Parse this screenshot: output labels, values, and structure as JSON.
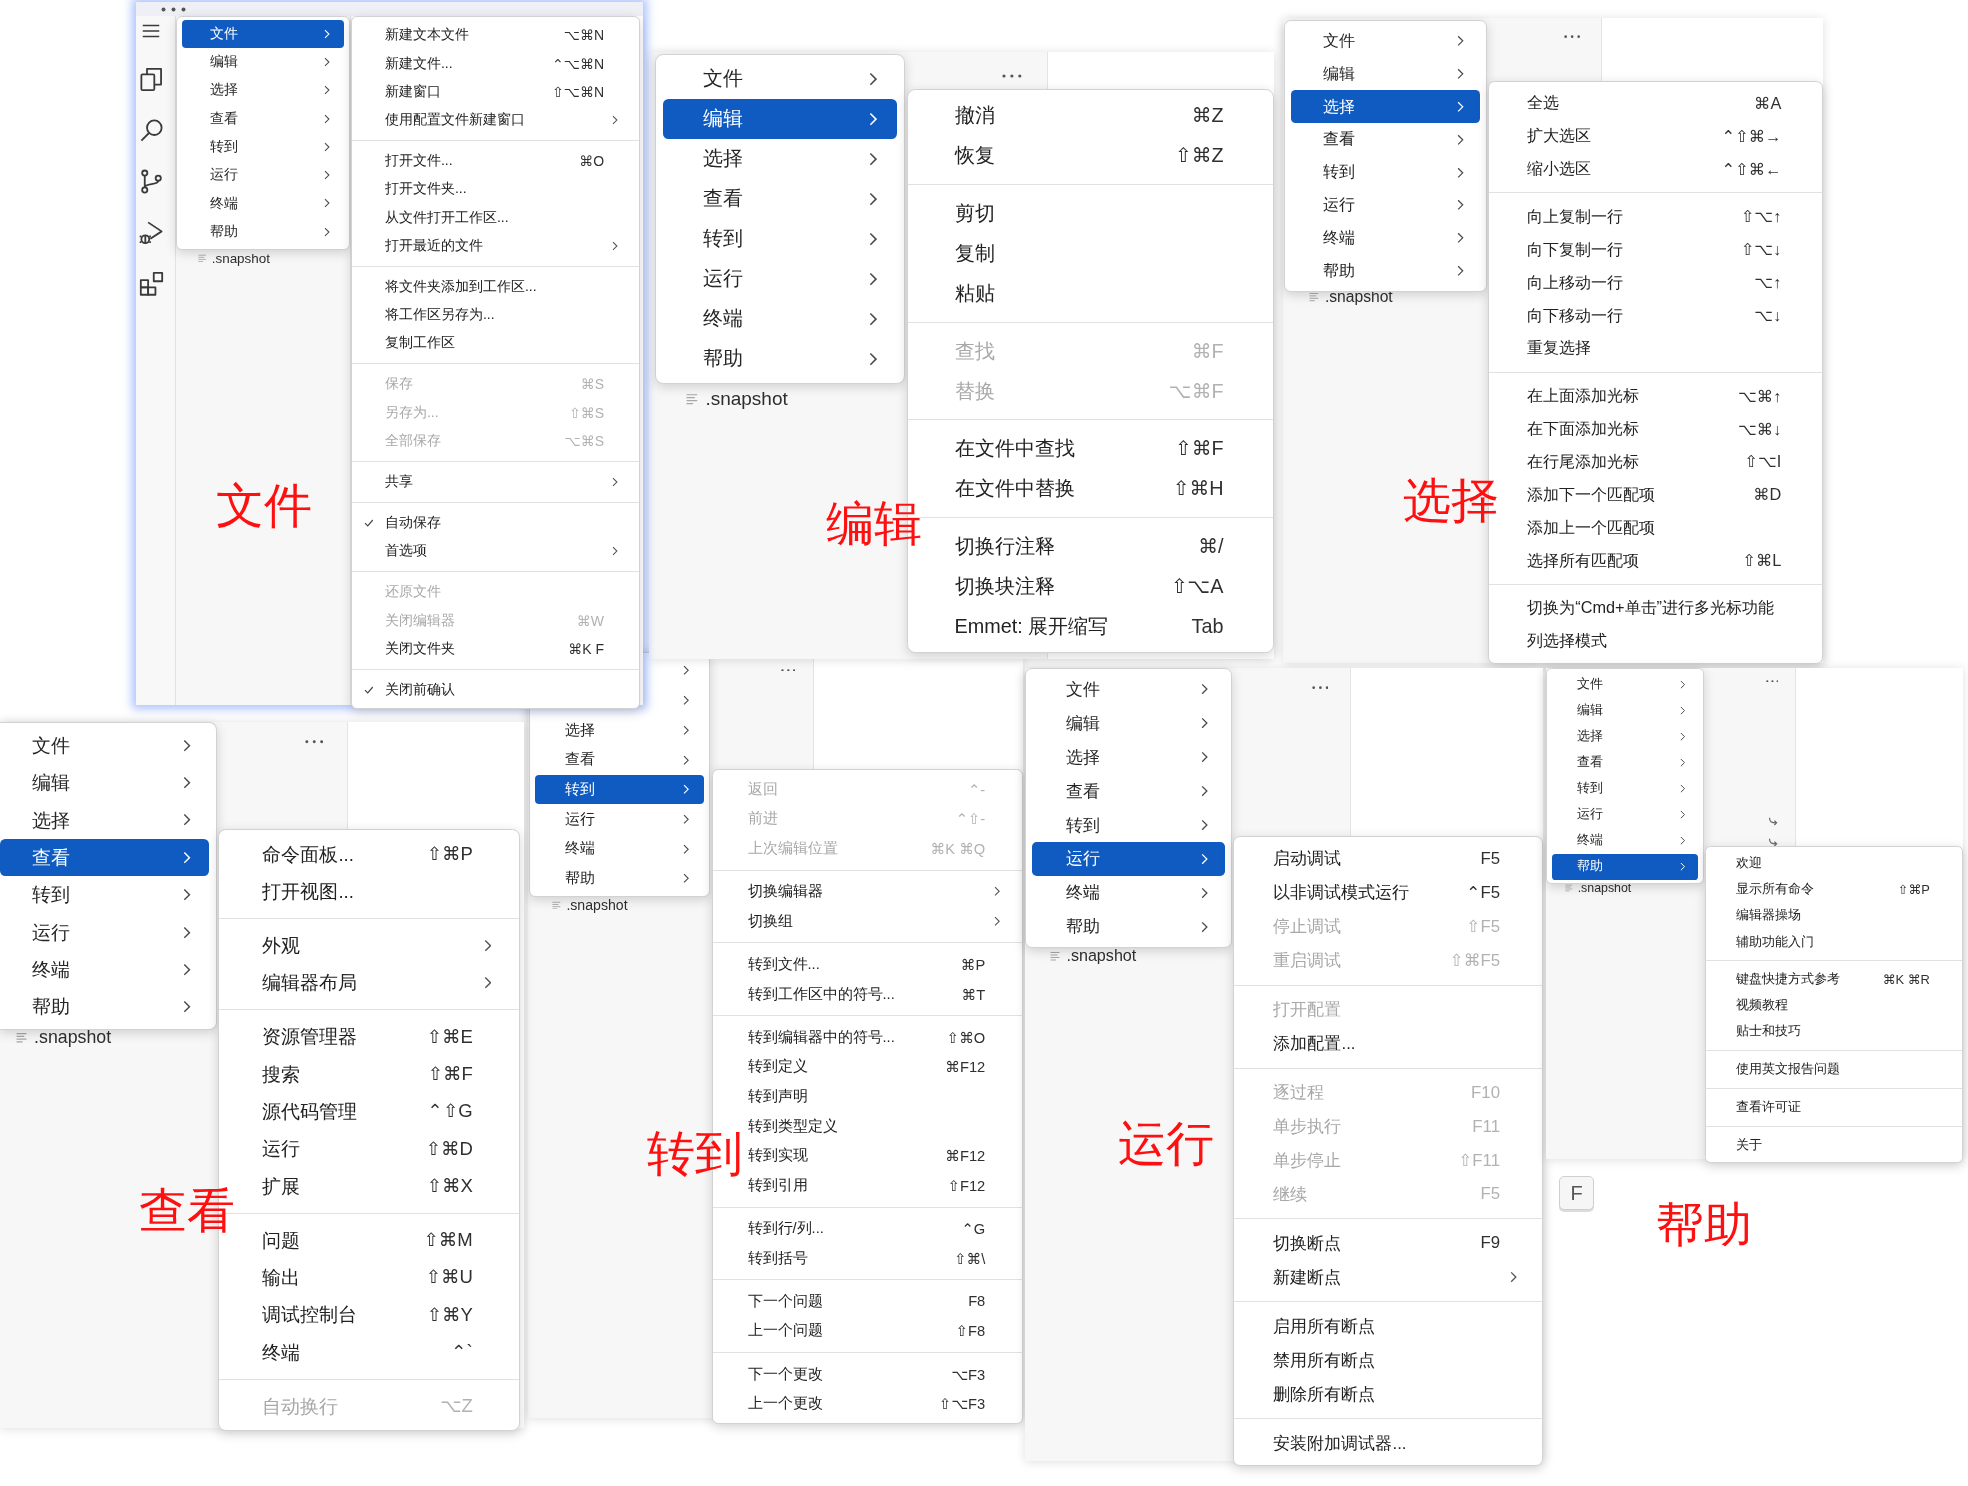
{
  "panels": [
    {
      "menu": [
        {
          "label": "文件",
          "selected": true
        },
        {
          "label": "编辑",
          "selected": false
        },
        {
          "label": "选择",
          "selected": false
        },
        {
          "label": "查看",
          "selected": false
        },
        {
          "label": "转到",
          "selected": false
        },
        {
          "label": "运行",
          "selected": false
        },
        {
          "label": "终端",
          "selected": false
        },
        {
          "label": "帮助",
          "selected": false
        }
      ],
      "file": ".snapshot",
      "submenu": [
        {
          "items": [
            {
              "label": "新建文本文件",
              "shortcut": "⌥⌘N",
              "disabled": false,
              "checked": false,
              "has_submenu": false
            },
            {
              "label": "新建文件...",
              "shortcut": "⌃⌥⌘N",
              "disabled": false,
              "checked": false,
              "has_submenu": false
            },
            {
              "label": "新建窗口",
              "shortcut": "⇧⌥⌘N",
              "disabled": false,
              "checked": false,
              "has_submenu": false
            },
            {
              "label": "使用配置文件新建窗口",
              "disabled": false,
              "checked": false,
              "has_submenu": true
            }
          ]
        },
        {
          "items": [
            {
              "label": "打开文件...",
              "shortcut": "⌘O",
              "disabled": false,
              "checked": false,
              "has_submenu": false
            },
            {
              "label": "打开文件夹...",
              "disabled": false,
              "checked": false,
              "has_submenu": false
            },
            {
              "label": "从文件打开工作区...",
              "disabled": false,
              "checked": false,
              "has_submenu": false
            },
            {
              "label": "打开最近的文件",
              "disabled": false,
              "checked": false,
              "has_submenu": true
            }
          ]
        },
        {
          "items": [
            {
              "label": "将文件夹添加到工作区...",
              "disabled": false,
              "checked": false,
              "has_submenu": false
            },
            {
              "label": "将工作区另存为...",
              "disabled": false,
              "checked": false,
              "has_submenu": false
            },
            {
              "label": "复制工作区",
              "disabled": false,
              "checked": false,
              "has_submenu": false
            }
          ]
        },
        {
          "items": [
            {
              "label": "保存",
              "shortcut": "⌘S",
              "disabled": true,
              "checked": false,
              "has_submenu": false
            },
            {
              "label": "另存为...",
              "shortcut": "⇧⌘S",
              "disabled": true,
              "checked": false,
              "has_submenu": false
            },
            {
              "label": "全部保存",
              "shortcut": "⌥⌘S",
              "disabled": true,
              "checked": false,
              "has_submenu": false
            }
          ]
        },
        {
          "items": [
            {
              "label": "共享",
              "disabled": false,
              "checked": false,
              "has_submenu": true
            }
          ]
        },
        {
          "items": [
            {
              "label": "自动保存",
              "disabled": false,
              "checked": true,
              "has_submenu": false
            },
            {
              "label": "首选项",
              "disabled": false,
              "checked": false,
              "has_submenu": true
            }
          ]
        },
        {
          "items": [
            {
              "label": "还原文件",
              "disabled": true,
              "checked": false,
              "has_submenu": false
            },
            {
              "label": "关闭编辑器",
              "shortcut": "⌘W",
              "disabled": true,
              "checked": false,
              "has_submenu": false
            },
            {
              "label": "关闭文件夹",
              "shortcut": "⌘K F",
              "disabled": false,
              "checked": false,
              "has_submenu": false
            }
          ]
        },
        {
          "items": [
            {
              "label": "关闭前确认",
              "disabled": false,
              "checked": true,
              "has_submenu": false
            }
          ]
        }
      ],
      "caption": "文件"
    },
    {
      "menu": [
        {
          "label": "文件",
          "selected": false
        },
        {
          "label": "编辑",
          "selected": true
        },
        {
          "label": "选择",
          "selected": false
        },
        {
          "label": "查看",
          "selected": false
        },
        {
          "label": "转到",
          "selected": false
        },
        {
          "label": "运行",
          "selected": false
        },
        {
          "label": "终端",
          "selected": false
        },
        {
          "label": "帮助",
          "selected": false
        }
      ],
      "file": ".snapshot",
      "submenu": [
        {
          "items": [
            {
              "label": "撤消",
              "shortcut": "⌘Z",
              "disabled": false,
              "has_submenu": false
            },
            {
              "label": "恢复",
              "shortcut": "⇧⌘Z",
              "disabled": false,
              "has_submenu": false
            }
          ]
        },
        {
          "items": [
            {
              "label": "剪切",
              "disabled": false,
              "has_submenu": false
            },
            {
              "label": "复制",
              "disabled": false,
              "has_submenu": false
            },
            {
              "label": "粘贴",
              "disabled": false,
              "has_submenu": false
            }
          ]
        },
        {
          "items": [
            {
              "label": "查找",
              "shortcut": "⌘F",
              "disabled": true,
              "has_submenu": false
            },
            {
              "label": "替换",
              "shortcut": "⌥⌘F",
              "disabled": true,
              "has_submenu": false
            }
          ]
        },
        {
          "items": [
            {
              "label": "在文件中查找",
              "shortcut": "⇧⌘F",
              "disabled": false,
              "has_submenu": false
            },
            {
              "label": "在文件中替换",
              "shortcut": "⇧⌘H",
              "disabled": false,
              "has_submenu": false
            }
          ]
        },
        {
          "items": [
            {
              "label": "切换行注释",
              "shortcut": "⌘/",
              "disabled": false,
              "has_submenu": false
            },
            {
              "label": "切换块注释",
              "shortcut": "⇧⌥A",
              "disabled": false,
              "has_submenu": false
            },
            {
              "label": "Emmet: 展开缩写",
              "shortcut": "Tab",
              "disabled": false,
              "has_submenu": false
            }
          ]
        }
      ],
      "caption": "编辑"
    },
    {
      "menu": [
        {
          "label": "文件",
          "selected": false
        },
        {
          "label": "编辑",
          "selected": false
        },
        {
          "label": "选择",
          "selected": true
        },
        {
          "label": "查看",
          "selected": false
        },
        {
          "label": "转到",
          "selected": false
        },
        {
          "label": "运行",
          "selected": false
        },
        {
          "label": "终端",
          "selected": false
        },
        {
          "label": "帮助",
          "selected": false
        }
      ],
      "file": ".snapshot",
      "submenu": [
        {
          "items": [
            {
              "label": "全选",
              "shortcut": "⌘A",
              "disabled": false,
              "has_submenu": false
            },
            {
              "label": "扩大选区",
              "shortcut": "⌃⇧⌘→",
              "disabled": false,
              "has_submenu": false
            },
            {
              "label": "缩小选区",
              "shortcut": "⌃⇧⌘←",
              "disabled": false,
              "has_submenu": false
            }
          ]
        },
        {
          "items": [
            {
              "label": "向上复制一行",
              "shortcut": "⇧⌥↑",
              "disabled": false,
              "has_submenu": false
            },
            {
              "label": "向下复制一行",
              "shortcut": "⇧⌥↓",
              "disabled": false,
              "has_submenu": false
            },
            {
              "label": "向上移动一行",
              "shortcut": "⌥↑",
              "disabled": false,
              "has_submenu": false
            },
            {
              "label": "向下移动一行",
              "shortcut": "⌥↓",
              "disabled": false,
              "has_submenu": false
            },
            {
              "label": "重复选择",
              "disabled": false,
              "has_submenu": false
            }
          ]
        },
        {
          "items": [
            {
              "label": "在上面添加光标",
              "shortcut": "⌥⌘↑",
              "disabled": false,
              "has_submenu": false
            },
            {
              "label": "在下面添加光标",
              "shortcut": "⌥⌘↓",
              "disabled": false,
              "has_submenu": false
            },
            {
              "label": "在行尾添加光标",
              "shortcut": "⇧⌥I",
              "disabled": false,
              "has_submenu": false
            },
            {
              "label": "添加下一个匹配项",
              "shortcut": "⌘D",
              "disabled": false,
              "has_submenu": false
            },
            {
              "label": "添加上一个匹配项",
              "disabled": false,
              "has_submenu": false
            },
            {
              "label": "选择所有匹配项",
              "shortcut": "⇧⌘L",
              "disabled": false,
              "has_submenu": false
            }
          ]
        },
        {
          "items": [
            {
              "label": "切换为“Cmd+单击”进行多光标功能",
              "disabled": false,
              "has_submenu": false
            },
            {
              "label": "列选择模式",
              "disabled": false,
              "has_submenu": false
            }
          ]
        }
      ],
      "caption": "选择"
    },
    {
      "menu": [
        {
          "label": "文件",
          "selected": false
        },
        {
          "label": "编辑",
          "selected": false
        },
        {
          "label": "选择",
          "selected": false
        },
        {
          "label": "查看",
          "selected": true
        },
        {
          "label": "转到",
          "selected": false
        },
        {
          "label": "运行",
          "selected": false
        },
        {
          "label": "终端",
          "selected": false
        },
        {
          "label": "帮助",
          "selected": false
        }
      ],
      "file": ".snapshot",
      "submenu": [
        {
          "items": [
            {
              "label": "命令面板...",
              "shortcut": "⇧⌘P",
              "disabled": false,
              "has_submenu": false
            },
            {
              "label": "打开视图...",
              "disabled": false,
              "has_submenu": false
            }
          ]
        },
        {
          "items": [
            {
              "label": "外观",
              "disabled": false,
              "has_submenu": true
            },
            {
              "label": "编辑器布局",
              "disabled": false,
              "has_submenu": true
            }
          ]
        },
        {
          "items": [
            {
              "label": "资源管理器",
              "shortcut": "⇧⌘E",
              "disabled": false,
              "has_submenu": false
            },
            {
              "label": "搜索",
              "shortcut": "⇧⌘F",
              "disabled": false,
              "has_submenu": false
            },
            {
              "label": "源代码管理",
              "shortcut": "⌃⇧G",
              "disabled": false,
              "has_submenu": false
            },
            {
              "label": "运行",
              "shortcut": "⇧⌘D",
              "disabled": false,
              "has_submenu": false
            },
            {
              "label": "扩展",
              "shortcut": "⇧⌘X",
              "disabled": false,
              "has_submenu": false
            }
          ]
        },
        {
          "items": [
            {
              "label": "问题",
              "shortcut": "⇧⌘M",
              "disabled": false,
              "has_submenu": false
            },
            {
              "label": "输出",
              "shortcut": "⇧⌘U",
              "disabled": false,
              "has_submenu": false
            },
            {
              "label": "调试控制台",
              "shortcut": "⇧⌘Y",
              "disabled": false,
              "has_submenu": false
            },
            {
              "label": "终端",
              "shortcut": "⌃`",
              "disabled": false,
              "has_submenu": false
            }
          ]
        },
        {
          "items": [
            {
              "label": "自动换行",
              "shortcut": "⌥Z",
              "disabled": true,
              "has_submenu": false
            }
          ]
        }
      ],
      "caption": "查看"
    },
    {
      "menu": [
        {
          "selected": false
        },
        {
          "selected": false
        },
        {
          "label": "选择",
          "selected": false
        },
        {
          "label": "查看",
          "selected": false
        },
        {
          "label": "转到",
          "selected": true
        },
        {
          "label": "运行",
          "selected": false
        },
        {
          "label": "终端",
          "selected": false
        },
        {
          "label": "帮助",
          "selected": false
        }
      ],
      "file": ".snapshot",
      "submenu": [
        {
          "items": [
            {
              "label": "返回",
              "shortcut": "⌃-",
              "disabled": true,
              "has_submenu": false
            },
            {
              "label": "前进",
              "shortcut": "⌃⇧-",
              "disabled": true,
              "has_submenu": false
            },
            {
              "label": "上次编辑位置",
              "shortcut": "⌘K ⌘Q",
              "disabled": true,
              "has_submenu": false
            }
          ]
        },
        {
          "items": [
            {
              "label": "切换编辑器",
              "disabled": false,
              "has_submenu": true
            },
            {
              "label": "切换组",
              "disabled": false,
              "has_submenu": true
            }
          ]
        },
        {
          "items": [
            {
              "label": "转到文件...",
              "shortcut": "⌘P",
              "disabled": false,
              "has_submenu": false
            },
            {
              "label": "转到工作区中的符号...",
              "shortcut": "⌘T",
              "disabled": false,
              "has_submenu": false
            }
          ]
        },
        {
          "items": [
            {
              "label": "转到编辑器中的符号...",
              "shortcut": "⇧⌘O",
              "disabled": false,
              "has_submenu": false
            },
            {
              "label": "转到定义",
              "shortcut": "⌘F12",
              "disabled": false,
              "has_submenu": false
            },
            {
              "label": "转到声明",
              "disabled": false,
              "has_submenu": false
            },
            {
              "label": "转到类型定义",
              "disabled": false,
              "has_submenu": false
            },
            {
              "label": "转到实现",
              "shortcut": "⌘F12",
              "disabled": false,
              "has_submenu": false
            },
            {
              "label": "转到引用",
              "shortcut": "⇧F12",
              "disabled": false,
              "has_submenu": false
            }
          ]
        },
        {
          "items": [
            {
              "label": "转到行/列...",
              "shortcut": "⌃G",
              "disabled": false,
              "has_submenu": false
            },
            {
              "label": "转到括号",
              "shortcut": "⇧⌘\\",
              "disabled": false,
              "has_submenu": false
            }
          ]
        },
        {
          "items": [
            {
              "label": "下一个问题",
              "shortcut": "F8",
              "disabled": false,
              "has_submenu": false
            },
            {
              "label": "上一个问题",
              "shortcut": "⇧F8",
              "disabled": false,
              "has_submenu": false
            }
          ]
        },
        {
          "items": [
            {
              "label": "下一个更改",
              "shortcut": "⌥F3",
              "disabled": false,
              "has_submenu": false
            },
            {
              "label": "上一个更改",
              "shortcut": "⇧⌥F3",
              "disabled": false,
              "has_submenu": false
            }
          ]
        }
      ],
      "caption": "转到"
    },
    {
      "menu": [
        {
          "label": "文件",
          "selected": false
        },
        {
          "label": "编辑",
          "selected": false
        },
        {
          "label": "选择",
          "selected": false
        },
        {
          "label": "查看",
          "selected": false
        },
        {
          "label": "转到",
          "selected": false
        },
        {
          "label": "运行",
          "selected": true
        },
        {
          "label": "终端",
          "selected": false
        },
        {
          "label": "帮助",
          "selected": false
        }
      ],
      "file": ".snapshot",
      "submenu": [
        {
          "items": [
            {
              "label": "启动调试",
              "shortcut": "F5",
              "disabled": false,
              "has_submenu": false
            },
            {
              "label": "以非调试模式运行",
              "shortcut": "⌃F5",
              "disabled": false,
              "has_submenu": false
            },
            {
              "label": "停止调试",
              "shortcut": "⇧F5",
              "disabled": true,
              "has_submenu": false
            },
            {
              "label": "重启调试",
              "shortcut": "⇧⌘F5",
              "disabled": true,
              "has_submenu": false
            }
          ]
        },
        {
          "items": [
            {
              "label": "打开配置",
              "disabled": true,
              "has_submenu": false
            },
            {
              "label": "添加配置...",
              "disabled": false,
              "has_submenu": false
            }
          ]
        },
        {
          "items": [
            {
              "label": "逐过程",
              "shortcut": "F10",
              "disabled": true,
              "has_submenu": false
            },
            {
              "label": "单步执行",
              "shortcut": "F11",
              "disabled": true,
              "has_submenu": false
            },
            {
              "label": "单步停止",
              "shortcut": "⇧F11",
              "disabled": true,
              "has_submenu": false
            },
            {
              "label": "继续",
              "shortcut": "F5",
              "disabled": true,
              "has_submenu": false
            }
          ]
        },
        {
          "items": [
            {
              "label": "切换断点",
              "shortcut": "F9",
              "disabled": false,
              "has_submenu": false
            },
            {
              "label": "新建断点",
              "disabled": false,
              "has_submenu": true
            }
          ]
        },
        {
          "items": [
            {
              "label": "启用所有断点",
              "disabled": false,
              "has_submenu": false
            },
            {
              "label": "禁用所有断点",
              "disabled": false,
              "has_submenu": false
            },
            {
              "label": "删除所有断点",
              "disabled": false,
              "has_submenu": false
            }
          ]
        },
        {
          "items": [
            {
              "label": "安装附加调试器...",
              "disabled": false,
              "has_submenu": false
            }
          ]
        }
      ],
      "caption": "运行"
    },
    {
      "menu": [
        {
          "label": "文件",
          "selected": false
        },
        {
          "label": "编辑",
          "selected": false
        },
        {
          "label": "选择",
          "selected": false
        },
        {
          "label": "查看",
          "selected": false
        },
        {
          "label": "转到",
          "selected": false
        },
        {
          "label": "运行",
          "selected": false
        },
        {
          "label": "终端",
          "selected": false
        },
        {
          "label": "帮助",
          "selected": true
        }
      ],
      "file": ".snapshot",
      "submenu": [
        {
          "items": [
            {
              "label": "欢迎",
              "disabled": false,
              "has_submenu": false
            },
            {
              "label": "显示所有命令",
              "shortcut": "⇧⌘P",
              "disabled": false,
              "has_submenu": false
            },
            {
              "label": "编辑器操场",
              "disabled": false,
              "has_submenu": false
            },
            {
              "label": "辅助功能入门",
              "disabled": false,
              "has_submenu": false
            }
          ]
        },
        {
          "items": [
            {
              "label": "键盘快捷方式参考",
              "shortcut": "⌘K ⌘R",
              "disabled": false,
              "has_submenu": false
            },
            {
              "label": "视频教程",
              "disabled": false,
              "has_submenu": false
            },
            {
              "label": "贴士和技巧",
              "disabled": false,
              "has_submenu": false
            }
          ]
        },
        {
          "items": [
            {
              "label": "使用英文报告问题",
              "disabled": false,
              "has_submenu": false
            }
          ]
        },
        {
          "items": [
            {
              "label": "查看许可证",
              "disabled": false,
              "has_submenu": false
            }
          ]
        },
        {
          "items": [
            {
              "label": "关于",
              "disabled": false,
              "has_submenu": false
            }
          ]
        }
      ],
      "caption": "帮助",
      "key": "F"
    }
  ]
}
